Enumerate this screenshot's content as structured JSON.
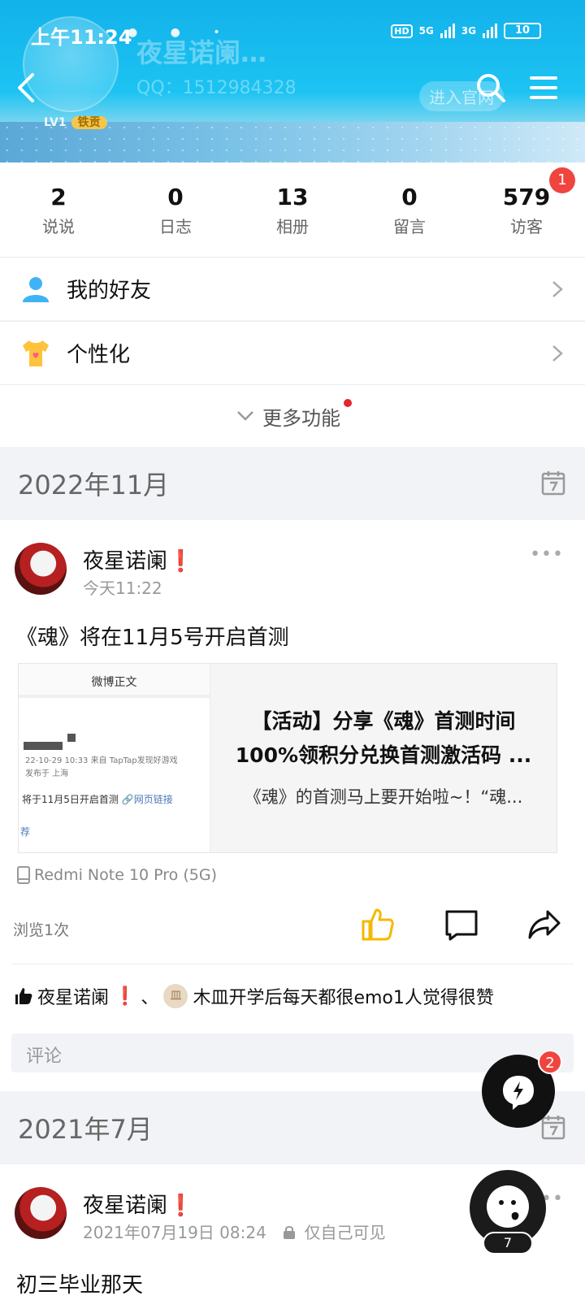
{
  "status_bar": {
    "time": "上午11:24",
    "hd": "HD",
    "net1": "5G",
    "net2": "3G",
    "battery": "10"
  },
  "header": {
    "name_ghost": "夜星诺阑…",
    "qq_ghost": "QQ：1512984328",
    "level": "LV1",
    "level_tag": "铁贡",
    "enter_site": "进入官网"
  },
  "stats": [
    {
      "num": "2",
      "label": "说说"
    },
    {
      "num": "0",
      "label": "日志"
    },
    {
      "num": "13",
      "label": "相册"
    },
    {
      "num": "0",
      "label": "留言"
    },
    {
      "num": "579",
      "label": "访客",
      "badge": "1"
    }
  ],
  "menu": {
    "friends": "我的好友",
    "personalize": "个性化",
    "more": "更多功能"
  },
  "sections": [
    {
      "month": "2022年11月"
    },
    {
      "month": "2021年7月"
    }
  ],
  "post1": {
    "name": "夜星诺阑",
    "exclaim": "❗",
    "time": "今天11:22",
    "text": "《魂》将在11月5号开启首测",
    "share": {
      "thumb_title": "微博正文",
      "thumb_meta1": "22-10-29 10:33  来自 TapTap发现好游戏",
      "thumb_meta2": "发布于 上海",
      "thumb_body": "将于11月5日开启首测",
      "thumb_link": "网页链接",
      "thumb_tail": "荐",
      "title_line1": "【活动】分享《魂》首测时间",
      "title_line2": "100%领积分兑换首测激活码 ...",
      "desc": "《魂》的首测马上要开始啦~！“魂..."
    },
    "device": "Redmi Note 10 Pro (5G)",
    "views": "浏览1次",
    "liker1": "夜星诺阑",
    "liker_sep": "、",
    "liker2_initial": "皿",
    "likes_text": "木皿开学后每天都很emo1人觉得很赞",
    "comment_placeholder": "评论"
  },
  "post2": {
    "name": "夜星诺阑",
    "exclaim": "❗",
    "time": "2021年07月19日 08:24",
    "visibility": "仅自己可见",
    "text_partial": "初三毕业那天"
  },
  "fab": {
    "badge": "2",
    "count": "7"
  }
}
